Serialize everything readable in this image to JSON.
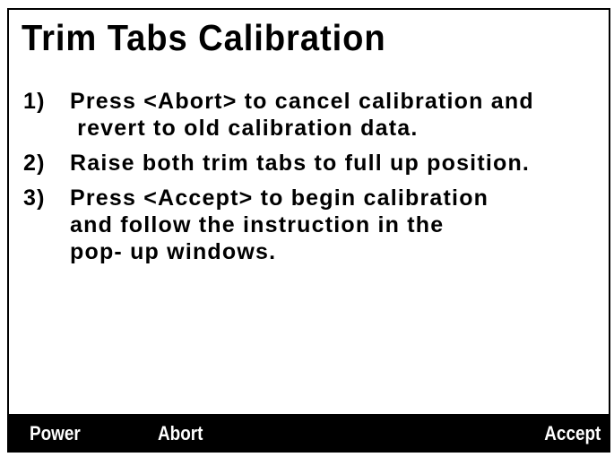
{
  "screen": {
    "title": "Trim Tabs Calibration"
  },
  "instructions": [
    {
      "number": "1)",
      "lines": [
        "Press <Abort> to cancel calibration and",
        " revert to old calibration data."
      ]
    },
    {
      "number": "2)",
      "lines": [
        "Raise both trim tabs to full up position."
      ]
    },
    {
      "number": "3)",
      "lines": [
        "Press <Accept> to begin calibration",
        "and follow the instruction in the",
        "pop- up windows."
      ]
    }
  ],
  "soft_keys": {
    "power": "Power",
    "abort": "Abort",
    "accept": "Accept"
  },
  "colors": {
    "background": "#ffffff",
    "text": "#000000",
    "soft_key_bar": "#000000",
    "soft_key_text": "#ffffff"
  }
}
